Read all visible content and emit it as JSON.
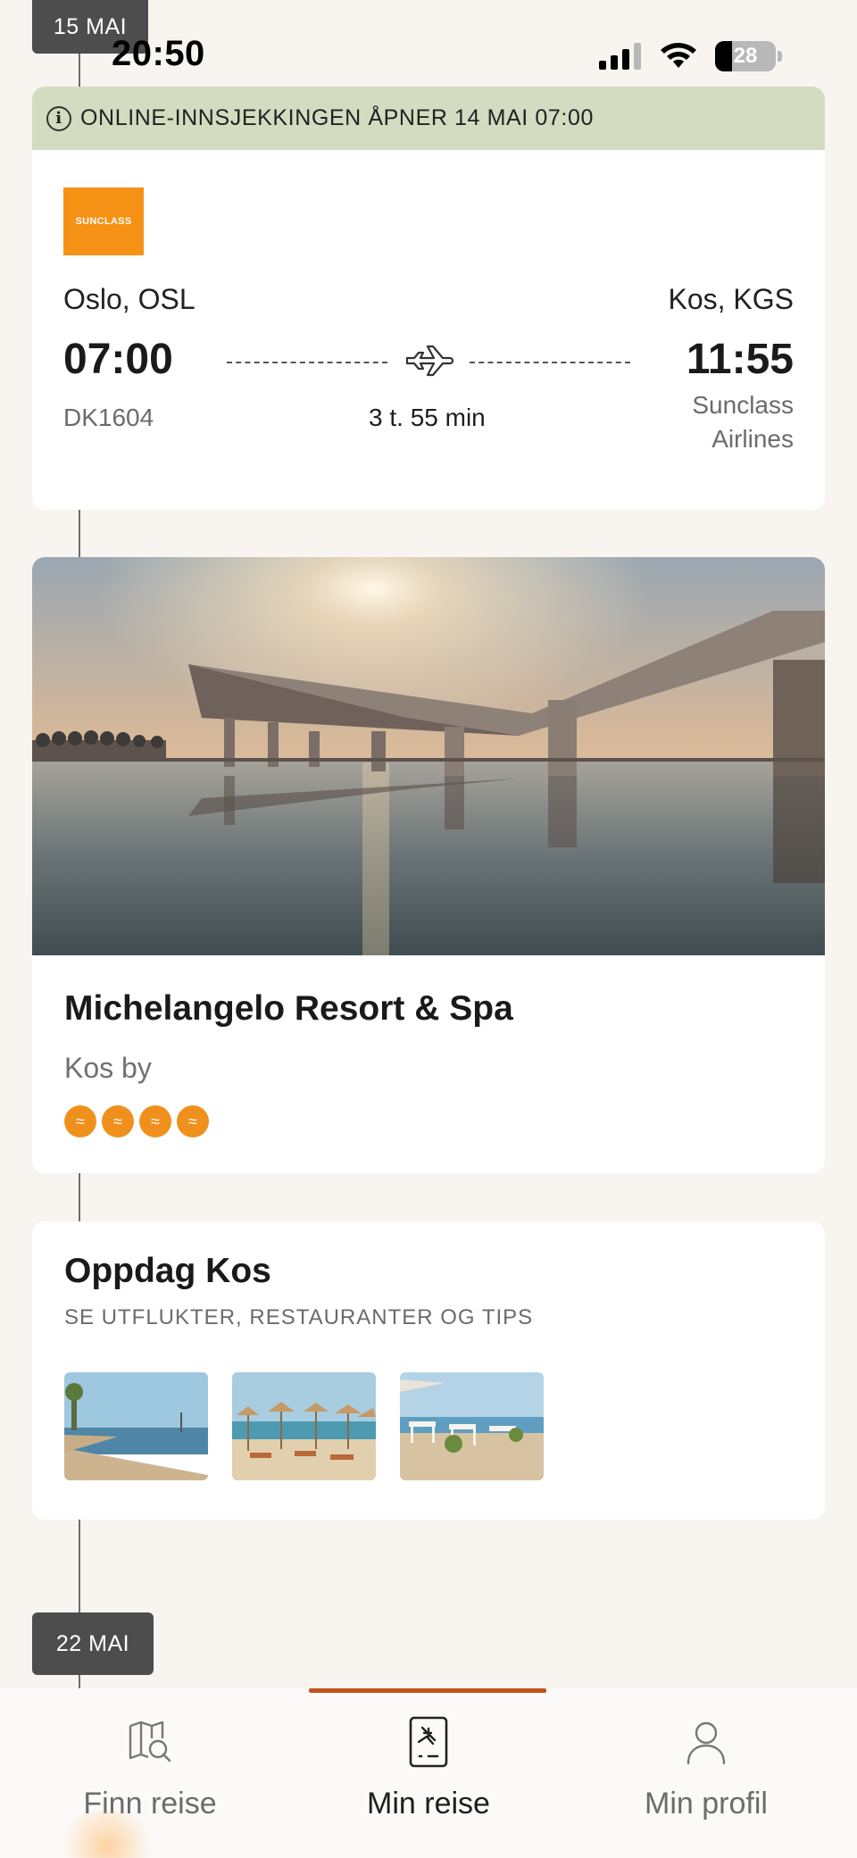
{
  "status_bar": {
    "time": "20:50",
    "battery": "28"
  },
  "timeline": {
    "date_top": "15 MAI",
    "date_bottom": "22 MAI"
  },
  "flight": {
    "checkin_notice": "ONLINE-INNSJEKKINGEN ÅPNER 14 MAI 07:00",
    "airline_logo_text": "SUNCLASS",
    "origin": "Oslo, OSL",
    "destination": "Kos, KGS",
    "departure_time": "07:00",
    "arrival_time": "11:55",
    "flight_number": "DK1604",
    "duration": "3 t. 55 min",
    "airline_line1": "Sunclass",
    "airline_line2": "Airlines"
  },
  "hotel": {
    "name": "Michelangelo Resort & Spa",
    "location": "Kos by",
    "rating": 4
  },
  "discover": {
    "title": "Oppdag Kos",
    "subtitle": "SE UTFLUKTER, RESTAURANTER OG TIPS"
  },
  "nav": {
    "items": [
      {
        "label": "Finn reise",
        "icon": "map-search-icon"
      },
      {
        "label": "Min reise",
        "icon": "boarding-pass-icon"
      },
      {
        "label": "Min profil",
        "icon": "person-icon"
      }
    ],
    "active": "Min reise"
  },
  "colors": {
    "accent": "#c2521e",
    "brand_orange": "#f59216",
    "banner_green": "#d3dcc0",
    "background": "#f8f4ef"
  }
}
